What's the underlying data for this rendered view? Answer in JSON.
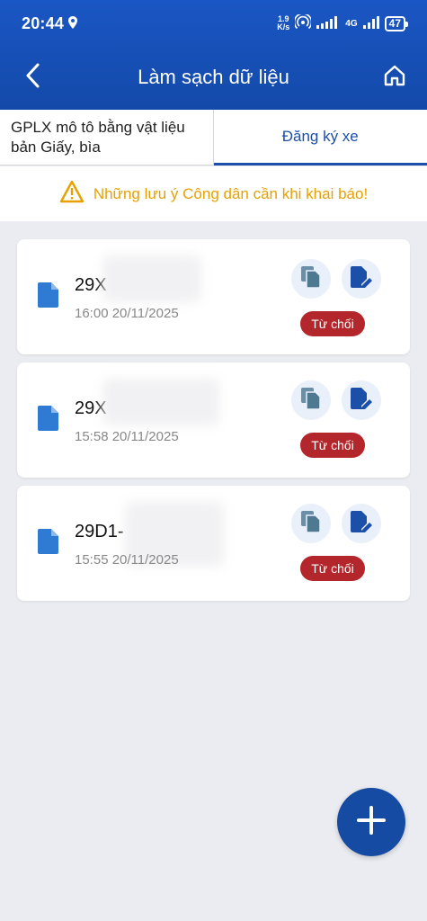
{
  "status_bar": {
    "time": "20:44",
    "net_speed_value": "1.9",
    "net_speed_unit": "K/s",
    "network": "4G",
    "battery": "47"
  },
  "app_bar": {
    "title": "Làm sạch dữ liệu",
    "back_icon": "chevron-left-icon",
    "home_icon": "home-icon"
  },
  "tabs": [
    {
      "label": "GPLX mô tô bằng vật liệu bản Giấy, bìa",
      "active": false
    },
    {
      "label": "Đăng ký xe",
      "active": true
    }
  ],
  "notice": {
    "text": "Những lưu ý Công dân cần khi khai báo!",
    "icon": "warning-icon",
    "color": "#e6a100"
  },
  "records": [
    {
      "plate": "29X",
      "time": "16:00 20/11/2025",
      "status": "Từ chối"
    },
    {
      "plate": "29X",
      "time": "15:58 20/11/2025",
      "status": "Từ chối"
    },
    {
      "plate": "29D1-",
      "time": "15:55 20/11/2025",
      "status": "Từ chối"
    }
  ],
  "colors": {
    "primary": "#1c4fa8",
    "status_rejected": "#b3262b",
    "background": "#ebecf1"
  },
  "fab": {
    "icon": "plus-icon"
  }
}
